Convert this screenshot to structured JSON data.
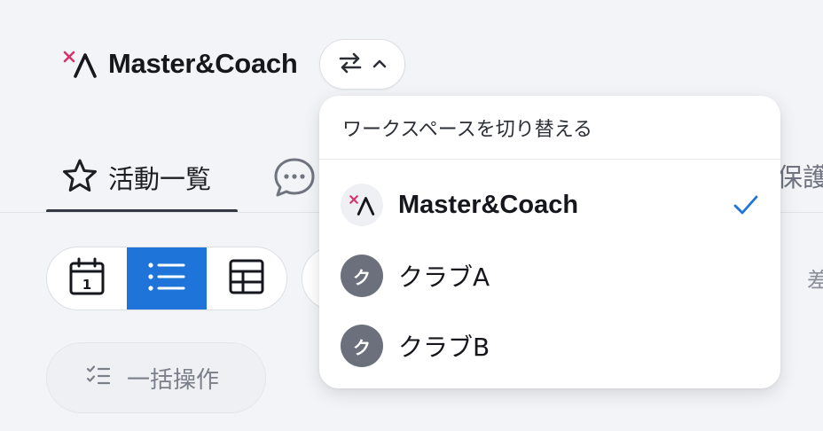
{
  "app": {
    "brand_name": "Master&Coach",
    "logo_icon": "master-coach-logo-icon",
    "switch_icon": "swap-arrows-icon",
    "switch_chevron": "chevron-up-icon"
  },
  "tabs": {
    "active_label": "活動一覧",
    "active_icon": "star-icon",
    "chat_icon": "chat-bubble-icon",
    "partial_label": "保護"
  },
  "view_toggle": {
    "items": [
      {
        "icon": "calendar-icon",
        "active": false
      },
      {
        "icon": "list-icon",
        "active": true
      },
      {
        "icon": "grid-icon",
        "active": false
      }
    ]
  },
  "toolbar": {
    "bulk_label": "一括操作",
    "bulk_icon": "checklist-icon",
    "faint_text_1": "：",
    "faint_text_2": "差"
  },
  "workspace_menu": {
    "header": "ワークスペースを切り替える",
    "items": [
      {
        "name": "Master&Coach",
        "avatar": "master-coach-logo-icon",
        "selected": true
      },
      {
        "name": "クラブA",
        "avatar_text": "ク",
        "selected": false
      },
      {
        "name": "クラブB",
        "avatar_text": "ク",
        "selected": false
      }
    ]
  },
  "colors": {
    "accent": "#1e74d8",
    "logo_red": "#d6336c",
    "avatar_gray": "#6b707c",
    "background": "#f3f4f7"
  }
}
